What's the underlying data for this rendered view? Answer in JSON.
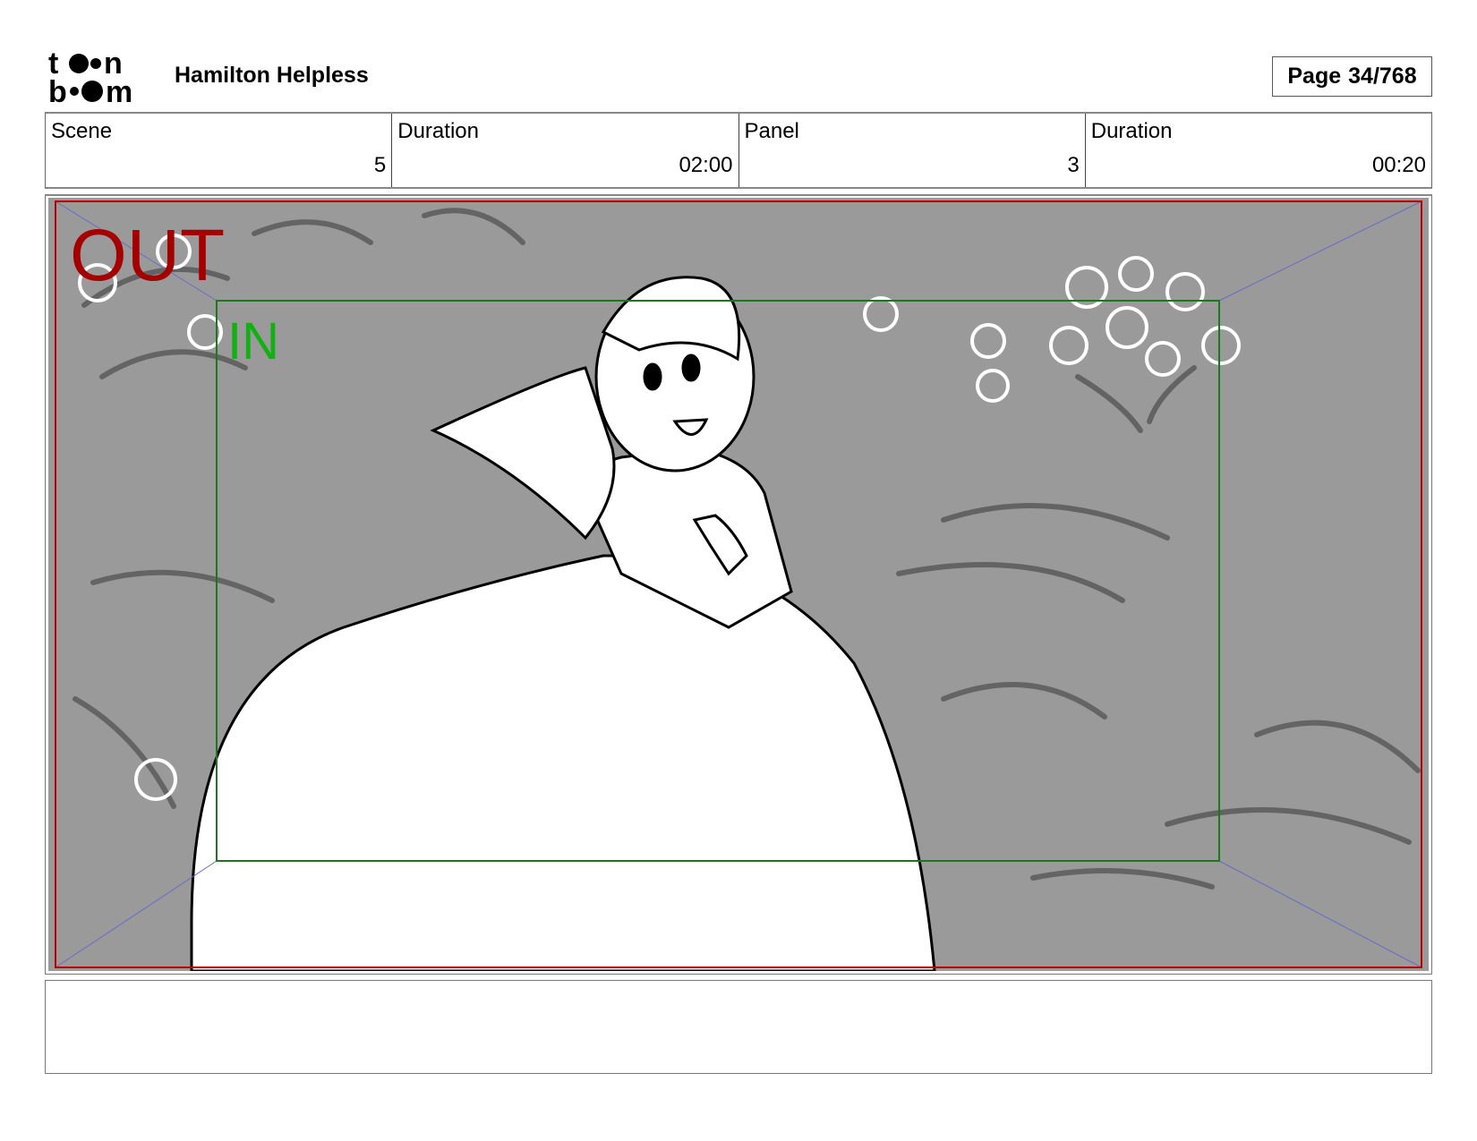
{
  "header": {
    "logo_text": "toon boom",
    "project_title": "Hamilton Helpless",
    "page_label": "Page",
    "page_value": "34/768"
  },
  "info": {
    "scene_label": "Scene",
    "scene_value": "5",
    "scene_duration_label": "Duration",
    "scene_duration_value": "02:00",
    "panel_label": "Panel",
    "panel_value": "3",
    "panel_duration_label": "Duration",
    "panel_duration_value": "00:20"
  },
  "panel": {
    "out_label": "OUT",
    "in_label": "IN"
  },
  "colors": {
    "background_gray": "#9a9a9a",
    "out_frame": "#c00000",
    "in_frame": "#1a7a1a",
    "diagonals": "#6a6ac8"
  }
}
